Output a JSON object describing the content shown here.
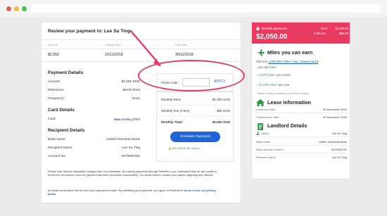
{
  "review": {
    "title": "Review your payment to: Lee Su Ting",
    "columns": [
      "Amount",
      "Charge Date",
      "Due Date"
    ],
    "values": [
      "$2,050",
      "22/11/2018",
      "30/11/2018"
    ]
  },
  "payment_details": {
    "heading": "Payment Details",
    "rows": [
      {
        "label": "Amount:",
        "value": "$2,050 SGD"
      },
      {
        "label": "Reference:",
        "value": "Month Rent"
      },
      {
        "label": "Frequency:",
        "value": "Once"
      }
    ]
  },
  "card_details": {
    "heading": "Card Details",
    "label": "Card:",
    "brand": "VISA",
    "value": "ending 0003"
  },
  "recipient_details": {
    "heading": "Recipient Details",
    "rows": [
      {
        "label": "Bank name:",
        "value": "United Overseas Bank"
      },
      {
        "label": "Recipient Name:",
        "value": "Lee Su Ting"
      },
      {
        "label": "Account No.",
        "value": "3478394781"
      }
    ]
  },
  "notes": {
    "disclaimer": "Please note that the transaction charges are non-refundable. By making payments through RentHero, you understand that we are unable to refund the full amount once the payment has been processed successfully. You would need to contact your payee regarding any refunds.",
    "email_prefix": "An email confirmation will be sent once payment is made. By submitting your payment, you agree to RentHero's ",
    "terms_link": "terms of use",
    "and": " and ",
    "privacy_link": "privacy policy",
    "end": "."
  },
  "promo": {
    "label": "Promo Code:",
    "value": "",
    "placeholder": "",
    "apply": "APPLY"
  },
  "summary": {
    "rows": [
      {
        "label": "Monthly Rent:",
        "value": "$2,000 SGD"
      },
      {
        "label": "Monthly Fee (2.5%):",
        "value": "$50 SGD"
      },
      {
        "label": "Monthly Total:",
        "value": "$2,050 SGD"
      }
    ],
    "button": "Schedule Payments",
    "ssl": "AES 256-bit SSL Secure"
  },
  "side": {
    "top_label": "Monthly payments",
    "amount": "$2,050.00",
    "rent_label": "Rent",
    "rent_value": "$2,000.00",
    "fee_label": "2.5% fee",
    "fee_value": "$50.00",
    "miles_heading": "Miles you can earn",
    "with_text": "With the ",
    "card_select": "UOB PRVI Miles Visa / Mastercard",
    "you_can_earn": ", you can earn:",
    "miles_month": "~ 2,870 miles*",
    "per_month": " per month",
    "miles_year": "~ 34,440 miles*",
    "per_year": " per year",
    "footnote": "* Based on miles conversion as of 31st of October",
    "lease_heading": "Lease Information",
    "lease_rows": [
      {
        "label": "Lease end date",
        "value": "30 November 2019"
      },
      {
        "label": "Payment due date",
        "value": "30 November 2018"
      }
    ],
    "landlord_heading": "Landlord Details",
    "landlord_rows": [
      {
        "label": "Name",
        "value": "Lee Su Ting"
      },
      {
        "label": "Bank name",
        "value": "United Overseas Bank"
      },
      {
        "label": "Bank account number",
        "value": "3478394781"
      },
      {
        "label": "Recipient name",
        "value": "Lee Su Ting"
      }
    ]
  },
  "colors": {
    "accent_pink": "#e93a62",
    "button_blue": "#1f64d9",
    "link_blue": "#1d5fa6",
    "green": "#2d9a43"
  }
}
